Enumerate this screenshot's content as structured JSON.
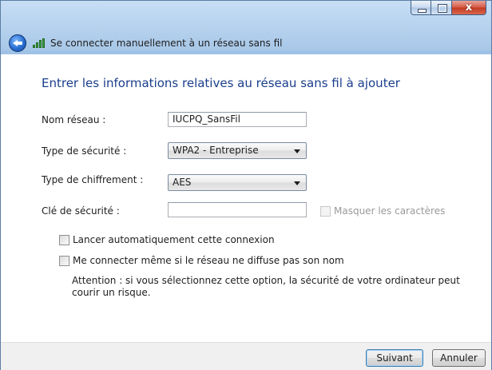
{
  "window": {
    "title": "Se connecter manuellement à un réseau sans fil",
    "close_glyph": "x"
  },
  "heading": "Entrer les informations relatives au réseau sans fil à ajouter",
  "form": {
    "network_name": {
      "label": "Nom réseau :",
      "value": "IUCPQ_SansFil"
    },
    "security_type": {
      "label": "Type de sécurité :",
      "value": "WPA2 - Entreprise"
    },
    "encryption_type": {
      "label": "Type de chiffrement :",
      "value": "AES"
    },
    "security_key": {
      "label": "Clé de sécurité :",
      "value": ""
    },
    "hide_characters": {
      "label": "Masquer les caractères",
      "checked": false,
      "enabled": false
    },
    "auto_connect": {
      "label": "Lancer automatiquement cette connexion",
      "checked": false
    },
    "connect_hidden": {
      "label": "Me connecter même si le réseau ne diffuse pas son nom",
      "checked": false
    },
    "warning": "Attention : si vous sélectionnez cette option, la sécurité de votre ordinateur peut courir un risque."
  },
  "buttons": {
    "next": "Suivant",
    "cancel": "Annuler"
  },
  "icons": {
    "back": "back-arrow-icon",
    "network": "wireless-signal-icon"
  }
}
